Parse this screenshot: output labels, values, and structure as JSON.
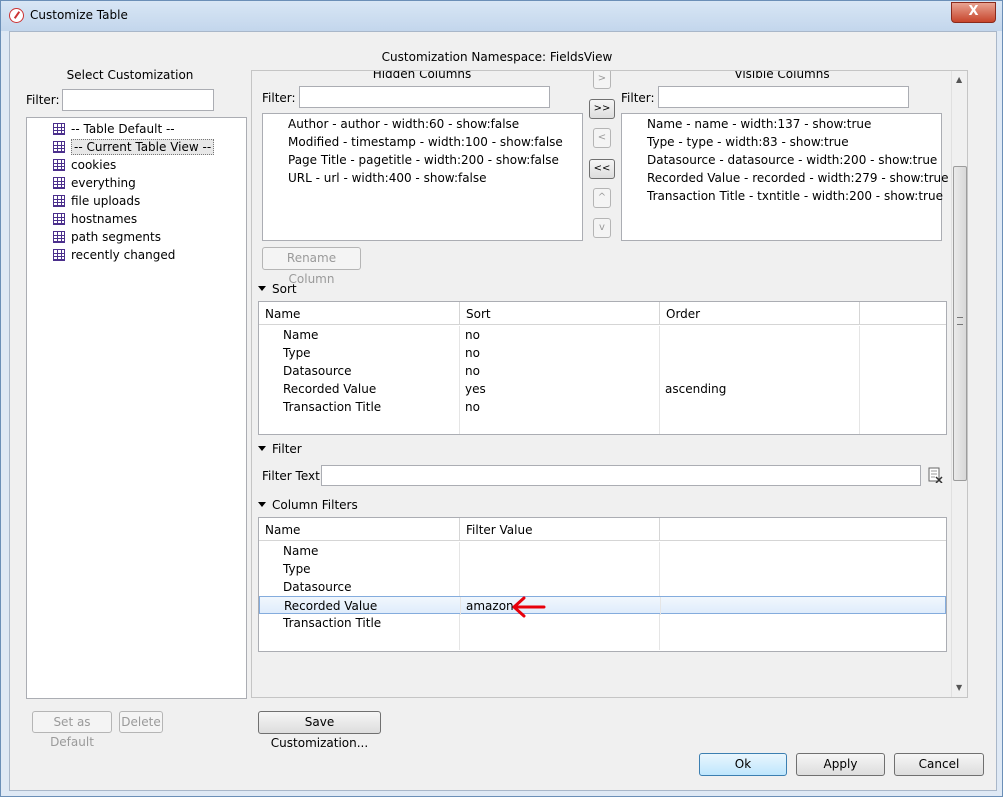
{
  "window": {
    "title": "Customize Table",
    "close_symbol": "X"
  },
  "namespace_label": "Customization Namespace: FieldsView",
  "left": {
    "heading": "Select Customization",
    "filter_label": "Filter:",
    "filter_value": "",
    "items": [
      {
        "label": "-- Table Default --",
        "selected": false
      },
      {
        "label": "-- Current Table View --",
        "selected": true
      },
      {
        "label": "cookies",
        "selected": false
      },
      {
        "label": "everything",
        "selected": false
      },
      {
        "label": "file uploads",
        "selected": false
      },
      {
        "label": "hostnames",
        "selected": false
      },
      {
        "label": "path segments",
        "selected": false
      },
      {
        "label": "recently changed",
        "selected": false
      }
    ],
    "set_default_label": "Set as Default",
    "delete_label": "Delete"
  },
  "columns": {
    "hidden_title": "Hidden Columns",
    "visible_title": "Visible Columns",
    "filter_label": "Filter:",
    "hidden": [
      "Author - author - width:60 - show:false",
      "Modified - timestamp - width:100 - show:false",
      "Page Title - pagetitle - width:200 - show:false",
      "URL - url - width:400 - show:false"
    ],
    "visible": [
      "Name - name - width:137 - show:true",
      "Type - type - width:83 - show:true",
      "Datasource - datasource - width:200 - show:true",
      "Recorded Value - recorded - width:279 - show:true",
      "Transaction Title - txntitle - width:200 - show:true"
    ],
    "move_buttons": [
      ">",
      ">>",
      "<",
      "<<",
      "^",
      "v"
    ],
    "rename_label": "Rename Column"
  },
  "sort": {
    "title": "Sort",
    "headers": [
      "Name",
      "Sort",
      "Order"
    ],
    "rows": [
      [
        "Name",
        "no",
        ""
      ],
      [
        "Type",
        "no",
        ""
      ],
      [
        "Datasource",
        "no",
        ""
      ],
      [
        "Recorded Value",
        "yes",
        "ascending"
      ],
      [
        "Transaction Title",
        "no",
        ""
      ]
    ]
  },
  "filter": {
    "title": "Filter",
    "text_label": "Filter Text:",
    "text_value": ""
  },
  "column_filters": {
    "title": "Column Filters",
    "headers": [
      "Name",
      "Filter Value"
    ],
    "rows": [
      [
        "Name",
        ""
      ],
      [
        "Type",
        ""
      ],
      [
        "Datasource",
        ""
      ],
      [
        "Recorded Value",
        "amazon"
      ],
      [
        "Transaction Title",
        ""
      ]
    ],
    "selected_row": 3
  },
  "buttons": {
    "save_customization": "Save Customization...",
    "ok": "Ok",
    "apply": "Apply",
    "cancel": "Cancel"
  },
  "colors": {
    "annotation_arrow": "#e8000b",
    "selection": "#dfecfb"
  }
}
